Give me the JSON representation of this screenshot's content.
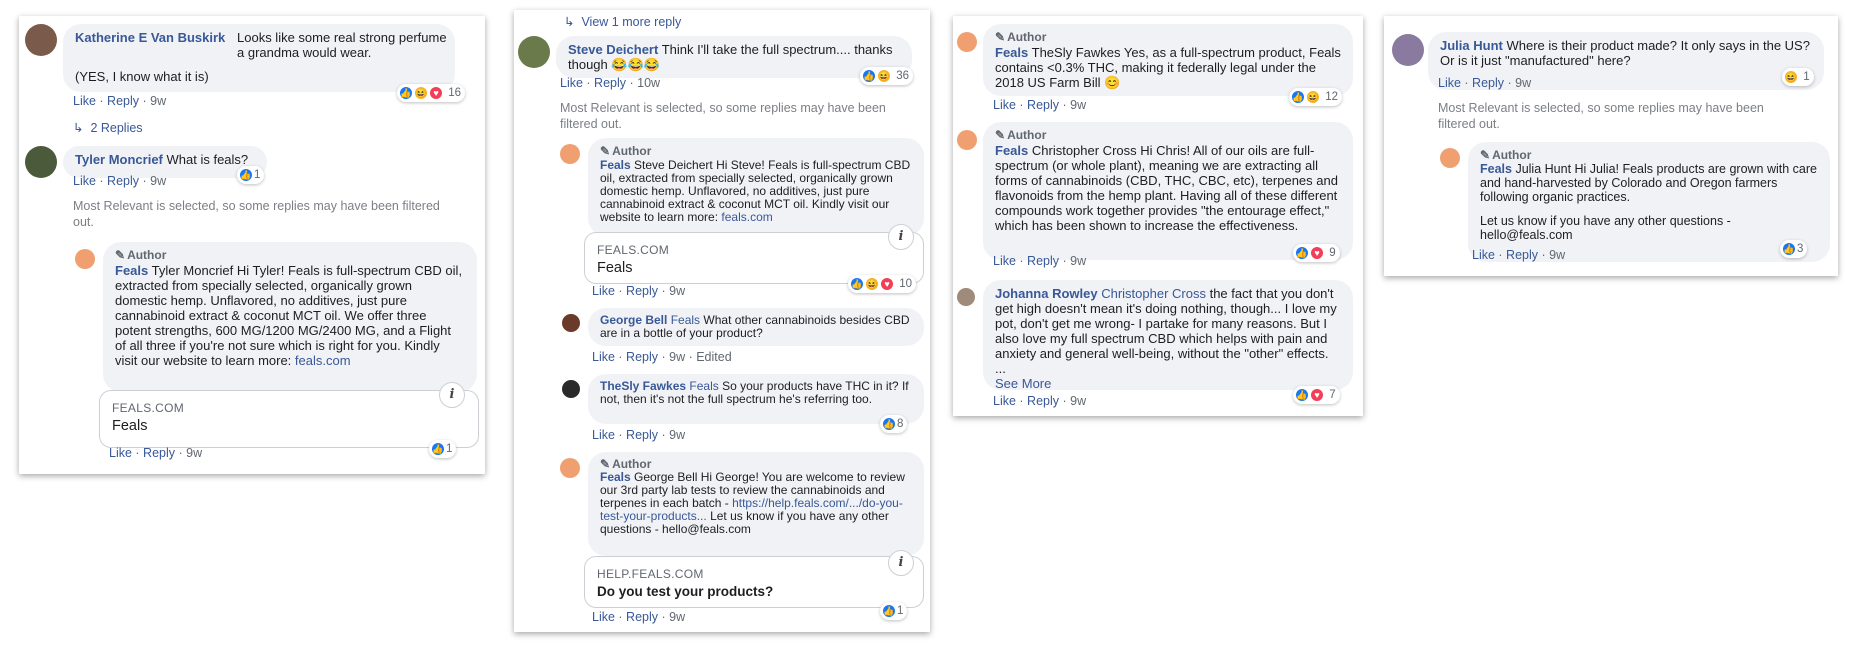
{
  "panel1": {
    "c1": {
      "name": "Katherine E Van Buskirk",
      "text": "Looks like some real strong perfume a grandma would wear.",
      "text2": "(YES, I know what it is)",
      "actions": [
        "Like",
        "Reply",
        "9w"
      ],
      "reactions": "16"
    },
    "replies": "2 Replies",
    "c2": {
      "name": "Tyler Moncrief",
      "text": "What is feals?",
      "actions": [
        "Like",
        "Reply",
        "9w"
      ],
      "reactions": "1"
    },
    "note": "Most Relevant is selected, so some replies may have been filtered out.",
    "c3": {
      "author": "Author",
      "name": "Feals",
      "mention": "Tyler Moncrief",
      "text": "Hi Tyler! Feals is full-spectrum CBD oil, extracted from specially selected, organically grown domestic hemp. Unflavored, no additives, just pure cannabinoid extract & coconut MCT oil. We offer three potent strengths, 600 MG/1200 MG/2400 MG, and a Flight of all three if you're not sure which is right for you. Kindly visit our website to learn more:",
      "link": "feals.com",
      "actions": [
        "Like",
        "Reply",
        "9w"
      ],
      "reactions": "1"
    },
    "card": {
      "domain": "FEALS.COM",
      "title": "Feals"
    }
  },
  "panel2": {
    "more": "View 1 more reply",
    "c1": {
      "name": "Steve Deichert",
      "text": "Think I'll take the full spectrum.... thanks though 😂😂😂",
      "actions": [
        "Like",
        "Reply",
        "10w"
      ],
      "reactions": "36"
    },
    "note": "Most Relevant is selected, so some replies may have been filtered out.",
    "c2": {
      "author": "Author",
      "name": "Feals",
      "mention": "Steve Deichert",
      "text": "Hi Steve! Feals is full-spectrum CBD oil, extracted from specially selected, organically grown domestic hemp. Unflavored, no additives, just pure cannabinoid extract & coconut MCT oil. Kindly visit our website to learn more:",
      "link": "feals.com",
      "actions": [
        "Like",
        "Reply",
        "9w"
      ],
      "reactions": "10"
    },
    "card": {
      "domain": "FEALS.COM",
      "title": "Feals"
    },
    "c3": {
      "name": "George Bell",
      "mention": "Feals",
      "text": "What other cannabinoids besides CBD are in a bottle of your product?",
      "actions": [
        "Like",
        "Reply",
        "9w",
        "Edited"
      ]
    },
    "c4": {
      "name": "TheSly Fawkes",
      "mention": "Feals",
      "text": "So your products have THC in it? If not, then it's not the full spectrum he's referring too.",
      "actions": [
        "Like",
        "Reply",
        "9w"
      ],
      "reactions": "8"
    },
    "c5": {
      "author": "Author",
      "name": "Feals",
      "mention": "George Bell",
      "text": "Hi George! You are welcome to review our 3rd party lab tests to review the cannabinoids and terpenes in each batch -",
      "link": "https://help.feals.com/.../do-you-test-your-products...",
      "text2": "Let us know if you have any other questions - hello@feals.com",
      "actions": [
        "Like",
        "Reply",
        "9w"
      ],
      "reactions": "1"
    },
    "card2": {
      "domain": "HELP.FEALS.COM",
      "title": "Do you test your products?"
    }
  },
  "panel3": {
    "c1": {
      "author": "Author",
      "name": "Feals",
      "mention": "TheSly Fawkes",
      "text": "Yes, as a full-spectrum product, Feals contains <0.3% THC, making it federally legal under the 2018 US Farm Bill 😊",
      "actions": [
        "Like",
        "Reply",
        "9w"
      ],
      "reactions": "12"
    },
    "c2": {
      "author": "Author",
      "name": "Feals",
      "mention": "Christopher Cross",
      "text": "Hi Chris! All of our oils are full-spectrum (or whole plant), meaning we are extracting all forms of cannabinoids (CBD, THC, CBC, etc), terpenes and flavonoids from the hemp plant. Having all of these different compounds work together provides \"the entourage effect,\" which has been shown to increase the effectiveness.",
      "actions": [
        "Like",
        "Reply",
        "9w"
      ],
      "reactions": "9"
    },
    "c3": {
      "name": "Johanna Rowley",
      "mention": "Christopher Cross",
      "text": "the fact that you don't get high doesn't mean it's doing nothing, though... I love my pot, don't get me wrong- I partake for many reasons. But I also love my full spectrum CBD which helps with pain and anxiety and general well-being, without the \"other\" effects. ...",
      "more": "See More",
      "actions": [
        "Like",
        "Reply",
        "9w"
      ],
      "reactions": "7"
    }
  },
  "panel4": {
    "c1": {
      "name": "Julia Hunt",
      "text": "Where is their product made? It only says in the US? Or is it just \"manufactured\" here?",
      "actions": [
        "Like",
        "Reply",
        "9w"
      ],
      "reactions": "1"
    },
    "note": "Most Relevant is selected, so some replies may have been filtered out.",
    "c2": {
      "author": "Author",
      "name": "Feals",
      "mention": "Julia Hunt",
      "text": "Hi Julia! Feals products are grown with care and hand-harvested by Colorado and Oregon farmers following organic practices.",
      "text2": "Let us know if you have any other questions - hello@feals.com",
      "actions": [
        "Like",
        "Reply",
        "9w"
      ],
      "reactions": "3"
    }
  }
}
